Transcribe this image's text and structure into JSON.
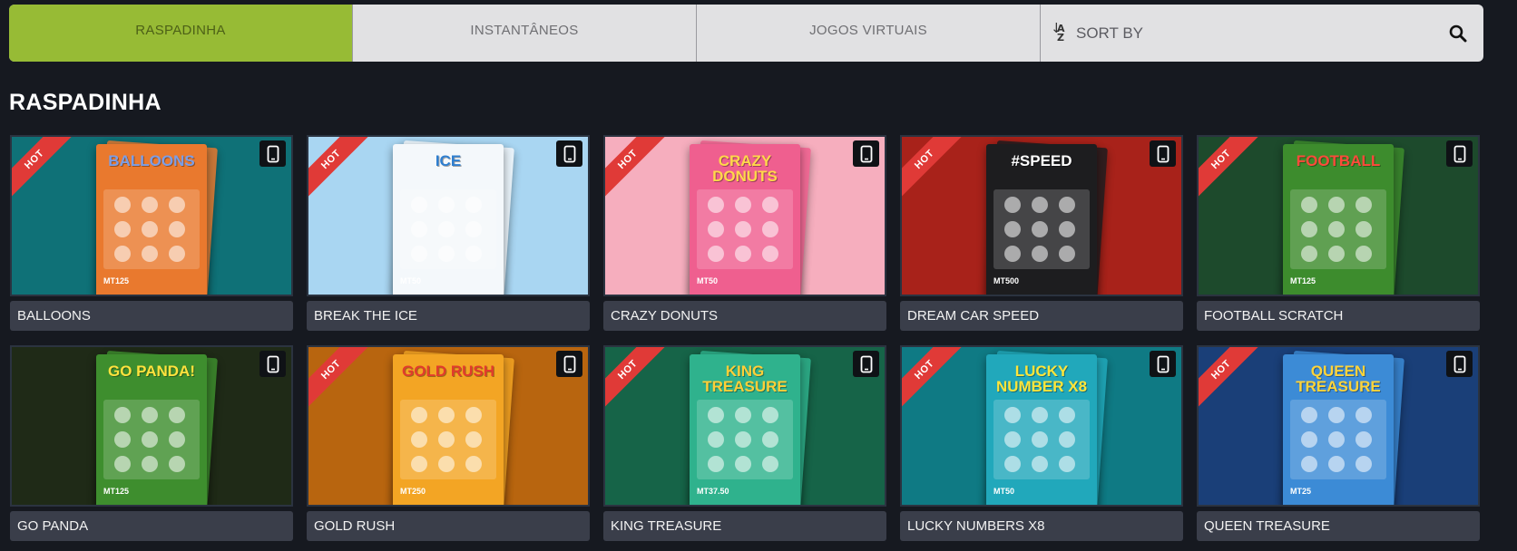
{
  "tabs": [
    {
      "label": "RASPADINHA",
      "active": true
    },
    {
      "label": "INSTANTÂNEOS",
      "active": false
    },
    {
      "label": "JOGOS VIRTUAIS",
      "active": false
    }
  ],
  "sort": {
    "label": "SORT BY",
    "icon": "sort-az-icon"
  },
  "search": {
    "icon": "search-icon"
  },
  "section_title": "RASPADINHA",
  "hot_label": "HOT",
  "games": [
    {
      "name": "BALLOONS",
      "hot": true,
      "art_title": "BALLOONS",
      "price": "MT125",
      "bg": "#0f7177",
      "ticket": "#e9792e",
      "title_color": "#7a9ee8"
    },
    {
      "name": "BREAK THE ICE",
      "hot": true,
      "art_title": "ICE",
      "price": "MT50",
      "bg": "#a9d6f2",
      "ticket": "#f4f8fb",
      "title_color": "#2e7fd0"
    },
    {
      "name": "CRAZY DONUTS",
      "hot": true,
      "art_title": "CRAZY DONUTS",
      "price": "MT50",
      "bg": "#f6aebe",
      "ticket": "#ef5f8f",
      "title_color": "#ffd84a"
    },
    {
      "name": "DREAM CAR SPEED",
      "hot": true,
      "art_title": "#SPEED",
      "price": "MT500",
      "bg": "#a8221a",
      "ticket": "#1d1d1f",
      "title_color": "#ffffff"
    },
    {
      "name": "FOOTBALL SCRATCH",
      "hot": true,
      "art_title": "FOOTBALL",
      "price": "MT125",
      "bg": "#1d4a2c",
      "ticket": "#3d8c2d",
      "title_color": "#ff4a3a"
    },
    {
      "name": "GO PANDA",
      "hot": false,
      "art_title": "GO PANDA!",
      "price": "MT125",
      "bg": "#1f2a17",
      "ticket": "#3e8e2e",
      "title_color": "#ffe23d"
    },
    {
      "name": "GOLD RUSH",
      "hot": true,
      "art_title": "GOLD RUSH",
      "price": "MT250",
      "bg": "#b8650f",
      "ticket": "#f3a524",
      "title_color": "#e23b2d"
    },
    {
      "name": "KING TREASURE",
      "hot": true,
      "art_title": "KING TREASURE",
      "price": "MT37.50",
      "bg": "#166448",
      "ticket": "#2fb28d",
      "title_color": "#ffcf38"
    },
    {
      "name": "LUCKY NUMBERS X8",
      "hot": true,
      "art_title": "LUCKY NUMBER X8",
      "price": "MT50",
      "bg": "#0f7a84",
      "ticket": "#21a8bb",
      "title_color": "#ffe53a"
    },
    {
      "name": "QUEEN TREASURE",
      "hot": true,
      "art_title": "QUEEN TREASURE",
      "price": "MT25",
      "bg": "#1a3f78",
      "ticket": "#3c8bd6",
      "title_color": "#ffd43a"
    }
  ]
}
